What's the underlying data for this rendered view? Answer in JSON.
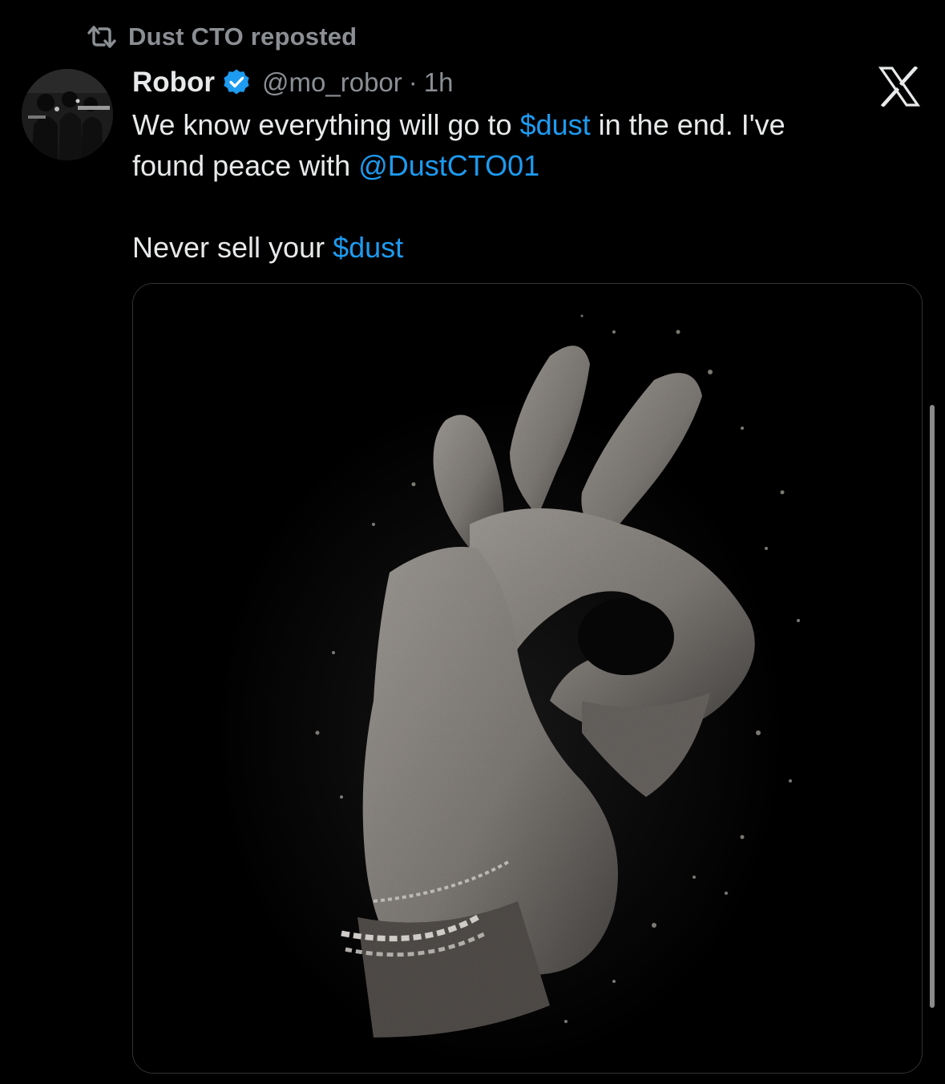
{
  "repost": {
    "icon": "repost-icon",
    "label": "Dust CTO reposted"
  },
  "tweet": {
    "author": {
      "display_name": "Robor",
      "verified": true,
      "handle": "@mo_robor",
      "separator": "·",
      "timestamp": "1h"
    },
    "text": {
      "line1_a": "We know everything will go to ",
      "line1_link": "$dust",
      "line1_b": " in the end. I've",
      "line2_a": "found peace with ",
      "line2_link": "@DustCTO01",
      "line3_a": "Never sell your ",
      "line3_link": "$dust"
    },
    "media": {
      "image_subject": "dust-hand-ok-gesture-image"
    }
  },
  "branding": {
    "logo": "x-logo-icon"
  },
  "colors": {
    "background": "#000000",
    "text_primary": "#e7e9ea",
    "text_secondary": "#8b8f94",
    "link": "#1d9bf0",
    "verified": "#1d9bf0",
    "border": "#2f3336"
  }
}
